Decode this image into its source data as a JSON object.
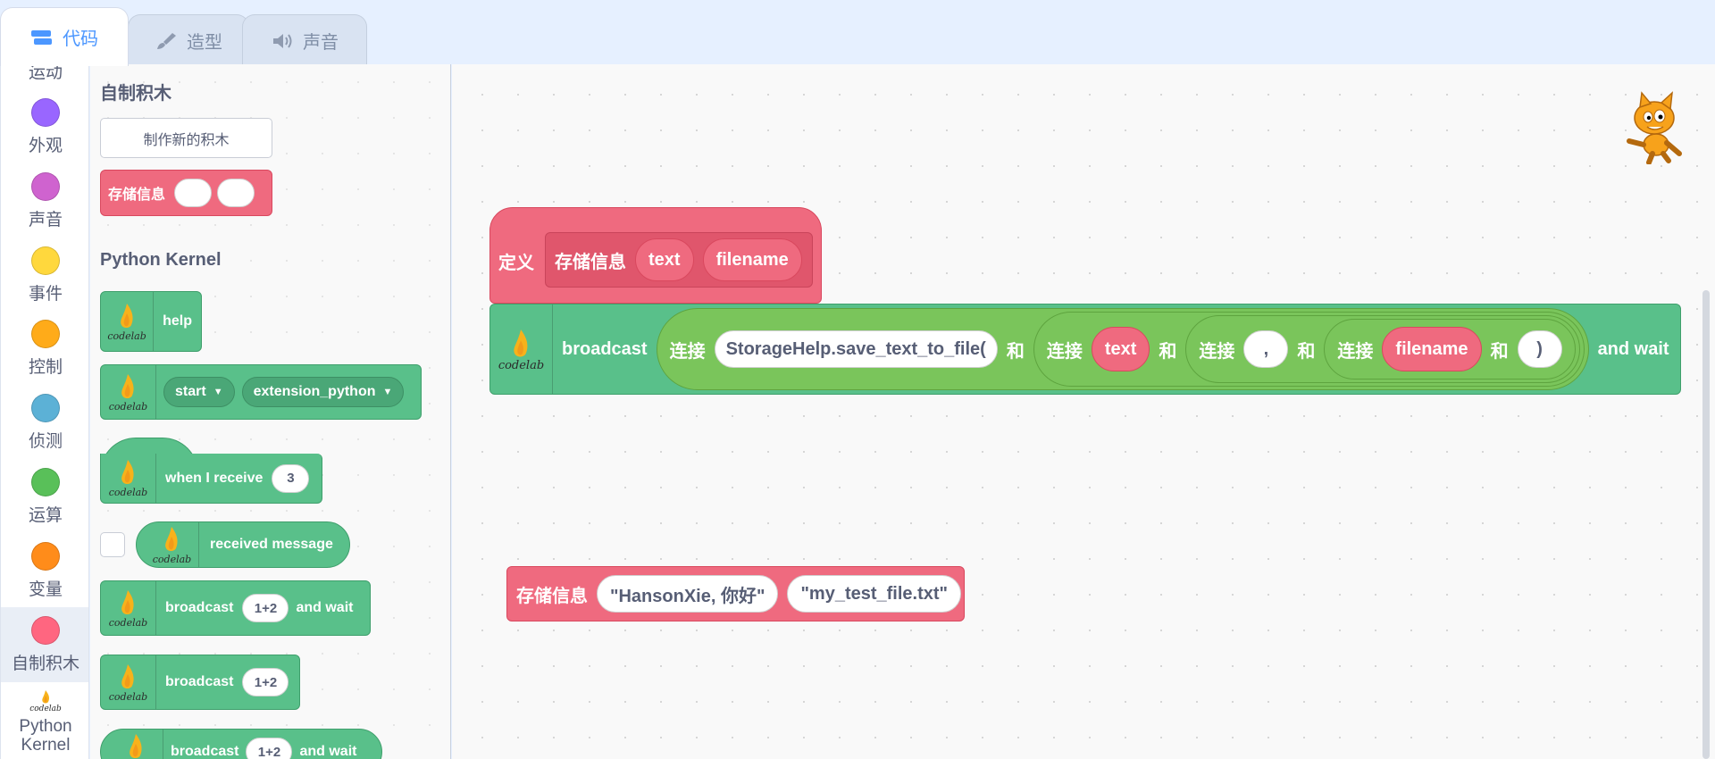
{
  "tabs": [
    {
      "label": "代码",
      "icon": "code-icon",
      "active": true
    },
    {
      "label": "造型",
      "icon": "brush-icon",
      "active": false
    },
    {
      "label": "声音",
      "icon": "speaker-icon",
      "active": false
    }
  ],
  "categories": [
    {
      "label": "运动",
      "color": "#4c97ff"
    },
    {
      "label": "外观",
      "color": "#9966ff"
    },
    {
      "label": "声音",
      "color": "#cf63cf"
    },
    {
      "label": "事件",
      "color": "#ffd83d"
    },
    {
      "label": "控制",
      "color": "#ffab19"
    },
    {
      "label": "侦测",
      "color": "#5cb1d6"
    },
    {
      "label": "运算",
      "color": "#59c059"
    },
    {
      "label": "变量",
      "color": "#ff8c1a"
    },
    {
      "label": "自制积木",
      "color": "#ff6680"
    },
    {
      "label": "Python Kernel",
      "logo": "codelab"
    }
  ],
  "flyout": {
    "section_my_blocks": "自制积木",
    "make_block_button": "制作新的积木",
    "proc_block_label": "存储信息",
    "section_python": "Python Kernel",
    "logo_text": "codelab",
    "help_label": "help",
    "start_dropdown": "start",
    "extension_dropdown": "extension_python",
    "when_receive_label": "when I receive",
    "when_receive_value": "3",
    "received_message_label": "received message",
    "broadcast_wait_label": "broadcast",
    "broadcast_wait_value": "1+2",
    "broadcast_wait_suffix": "and wait",
    "broadcast_label": "broadcast",
    "broadcast_value": "1+2",
    "broadcast_wait2_label": "broadcast",
    "broadcast_wait2_value": "1+2",
    "broadcast_wait2_suffix": "and wait"
  },
  "workspace": {
    "define_label": "定义",
    "define_proc": "存储信息",
    "define_param1": "text",
    "define_param2": "filename",
    "broadcast_label": "broadcast",
    "join1_label": "连接",
    "join1_string": "StorageHelp.save_text_to_file(",
    "and1": "和",
    "join2_label": "连接",
    "join2_var": "text",
    "and2": "和",
    "join3_label": "连接",
    "join3_string": ",",
    "and3": "和",
    "join4_label": "连接",
    "join4_var": "filename",
    "and4": "和",
    "join4_string": ")",
    "and_wait": "and wait",
    "call_label": "存储信息",
    "call_arg1": "\"HansonXie, 你好\"",
    "call_arg2": "\"my_test_file.txt\""
  },
  "colors": {
    "extension_green": "#59c08a",
    "my_blocks_pink": "#ef6a7f",
    "operator_green": "#7ac55b",
    "tab_active": "#4c97ff"
  }
}
